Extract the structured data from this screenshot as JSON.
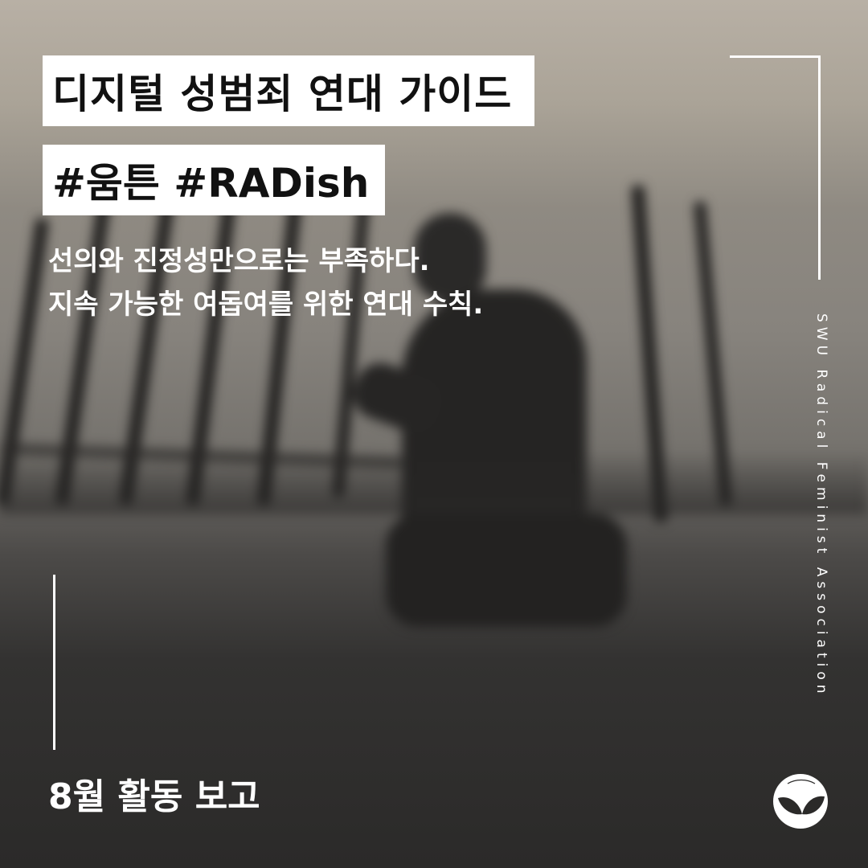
{
  "title": "디지털 성범죄 연대 가이드",
  "hashtags": "#움튼 #RADish",
  "subtitle": {
    "line1": "선의와 진정성만으로는 부족하다.",
    "line2": "지속 가능한 여돕여를 위한 연대 수칙."
  },
  "side_label": "SWU Radical Feminist Association",
  "footer": "8월 활동 보고",
  "logo": {
    "icon": "sprout-circle-logo"
  },
  "colors": {
    "title_bg": "#ffffff",
    "title_text": "#111111",
    "text": "#ffffff"
  }
}
